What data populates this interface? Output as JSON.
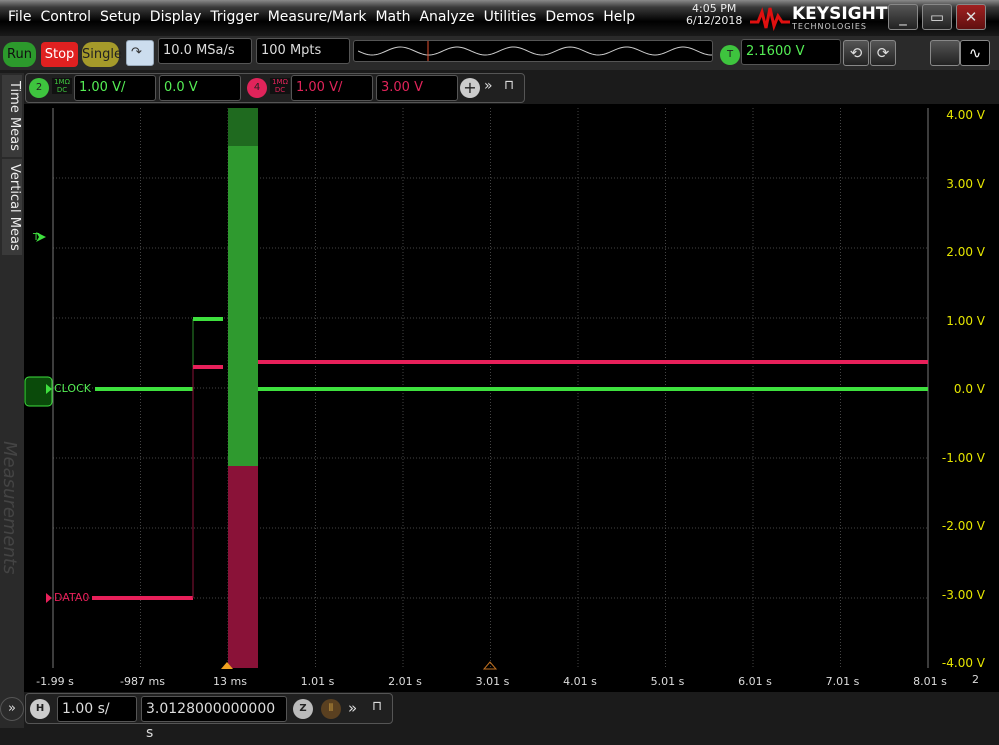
{
  "menu": [
    "File",
    "Control",
    "Setup",
    "Display",
    "Trigger",
    "Measure/Mark",
    "Math",
    "Analyze",
    "Utilities",
    "Demos",
    "Help"
  ],
  "clock": {
    "time": "4:05 PM",
    "date": "6/12/2018"
  },
  "logo": {
    "brand": "KEYSIGHT",
    "sub": "TECHNOLOGIES"
  },
  "toolbar": {
    "run": "Run",
    "stop": "Stop",
    "single": "Single",
    "sample_rate": "10.0 MSa/s",
    "memory": "100 Mpts",
    "trigger_label": "T",
    "trigger_level": "2.1600 V"
  },
  "channels": [
    {
      "num": "2",
      "impedance": "1MΩ",
      "coupling": "DC",
      "scale": "1.00 V/",
      "offset": "0.0 V",
      "color": "#3ec43e"
    },
    {
      "num": "4",
      "impedance": "1MΩ",
      "coupling": "DC",
      "scale": "1.00 V/",
      "offset": "3.00 V",
      "color": "#e0245a"
    }
  ],
  "side_tabs": [
    "Time Meas",
    "Vertical Meas",
    "Measurements"
  ],
  "traces": {
    "clock": "CLOCK",
    "data0": "DATA0",
    "trigger_marker": "T"
  },
  "y_axis": [
    "4.00 V",
    "3.00 V",
    "2.00 V",
    "1.00 V",
    "0.0 V",
    "-1.00 V",
    "-2.00 V",
    "-3.00 V",
    "-4.00 V"
  ],
  "x_axis": [
    "-1.99 s",
    "-987 ms",
    "13 ms",
    "1.01 s",
    "2.01 s",
    "3.01 s",
    "4.01 s",
    "5.01 s",
    "6.01 s",
    "7.01 s",
    "8.01 s"
  ],
  "x_axis_extra": "2",
  "horizontal": {
    "label": "H",
    "scale": "1.00 s/",
    "position": "3.0128000000000 s",
    "zoom": "Z"
  }
}
